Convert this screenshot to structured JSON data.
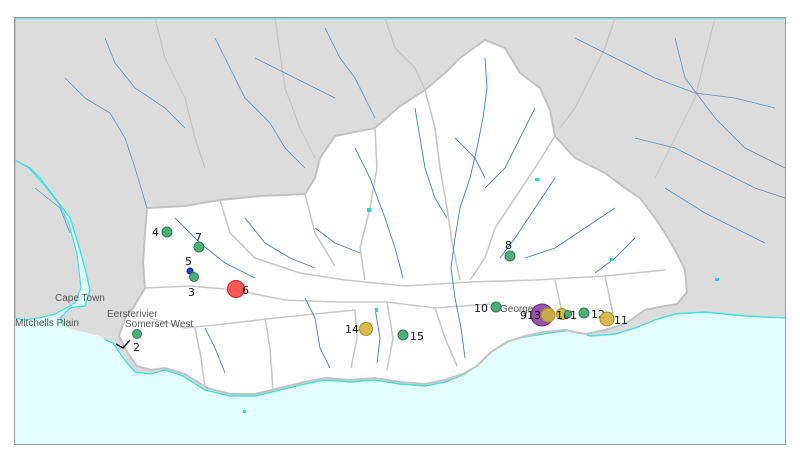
{
  "map": {
    "colors": {
      "ocean": "#e4ffff",
      "coast": "#40e0e0",
      "outside_land": "#dcdcdc",
      "region": "#ffffff",
      "boundary": "#c2c2c2",
      "river_outside": "#5f8fb8",
      "river_inside": "#3f7fc0",
      "water_bodies": "#1fd9d9"
    },
    "towns": [
      {
        "name": "Cape Town"
      },
      {
        "name": "Mitchells Plain"
      },
      {
        "name": "Eersterivier"
      },
      {
        "name": "Somerset West"
      },
      {
        "name": "George"
      }
    ],
    "sites": [
      {
        "label": "4",
        "color": "#4caf7a"
      },
      {
        "label": "7",
        "color": "#4caf7a"
      },
      {
        "label": "5",
        "color": "#2b3fc8"
      },
      {
        "label": "3",
        "color": "#4caf7a"
      },
      {
        "label": "6",
        "color": "#ff3b3b"
      },
      {
        "label": "2",
        "color": "#4caf7a"
      },
      {
        "label": "8",
        "color": "#4caf7a"
      },
      {
        "label": "10",
        "color": "#4caf7a"
      },
      {
        "label": "9",
        "color": "#8e3fa0"
      },
      {
        "label": "13",
        "color": "#d4b23a"
      },
      {
        "label": "16",
        "color": "#d4b23a"
      },
      {
        "label": "1",
        "color": "#4caf7a"
      },
      {
        "label": "12",
        "color": "#4caf7a"
      },
      {
        "label": "11",
        "color": "#d4b23a"
      },
      {
        "label": "14",
        "color": "#d4b23a"
      },
      {
        "label": "15",
        "color": "#4caf7a"
      }
    ]
  }
}
